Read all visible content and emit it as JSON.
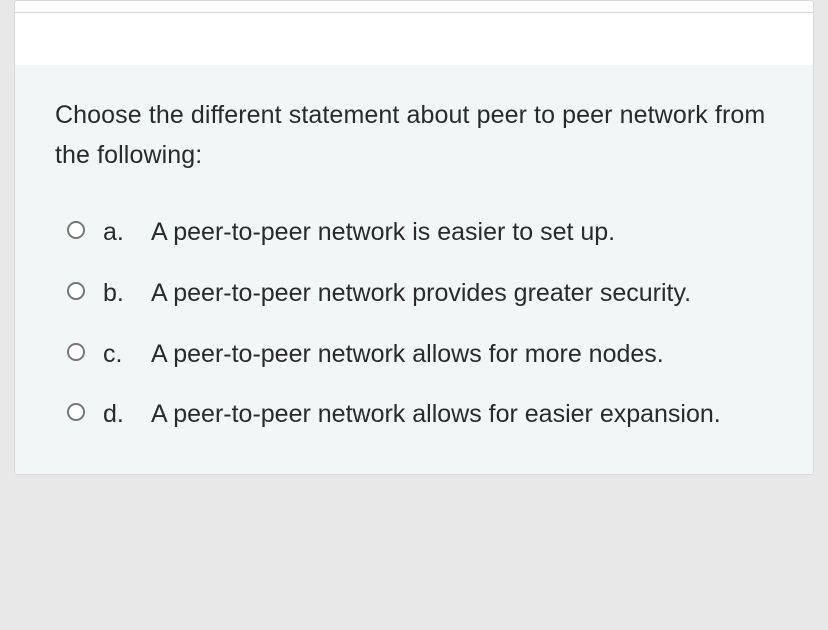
{
  "question": {
    "prompt": "Choose the different statement about peer to peer network from the following:",
    "options": [
      {
        "letter": "a.",
        "text": "A peer-to-peer network is easier to set up."
      },
      {
        "letter": "b.",
        "text": "A peer-to-peer network provides greater security."
      },
      {
        "letter": "c.",
        "text": "A peer-to-peer network allows for more nodes."
      },
      {
        "letter": "d.",
        "text": "A peer-to-peer network allows for easier expansion."
      }
    ]
  }
}
